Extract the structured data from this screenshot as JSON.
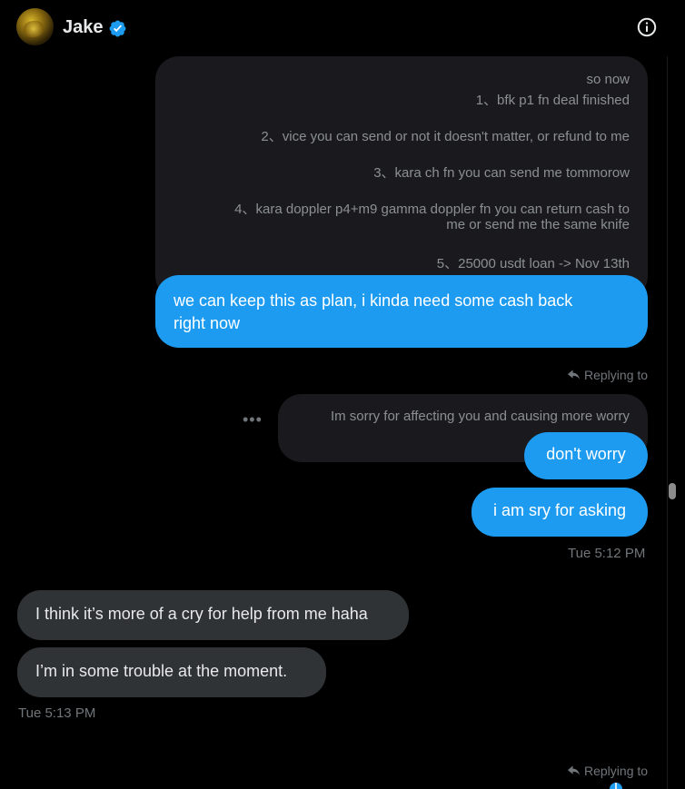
{
  "header": {
    "name": "Jake",
    "avatar_icon": "avatar-image",
    "verified_icon": "verified-badge-icon",
    "info_icon": "info-icon"
  },
  "messages": {
    "quoted_lines": [
      "so now",
      "1、bfk p1 fn deal finished",
      "2、vice you can send or not it doesn't matter, or refund to me",
      "3、kara ch fn you can send me tommorow",
      "4、kara doppler p4+m9 gamma doppler fn you can return cash to",
      "me or send me the same knife",
      "5、25000 usdt loan -> Nov 13th"
    ],
    "plan_line1": "we can keep this as plan, i kinda need some cash back",
    "plan_line2": "right now",
    "replying_to": "Replying to",
    "quoted_sorry": "Im sorry for affecting you and causing more worry",
    "more_dots": "•••",
    "dont_worry": "don't worry",
    "sry_asking": "i am sry for asking",
    "time_sent": "Tue 5:12 PM",
    "cry_help": "I think it’s more of a cry for help from me haha",
    "trouble": "I’m in some trouble at the moment.",
    "time_received": "Tue 5:13 PM",
    "replying_to_2": "Replying to"
  },
  "colors": {
    "accent": "#1d9bf0",
    "background": "#000000",
    "received_bubble": "#2f3336",
    "quoted_bg": "#1a1a1e",
    "muted_text": "#71767b"
  }
}
